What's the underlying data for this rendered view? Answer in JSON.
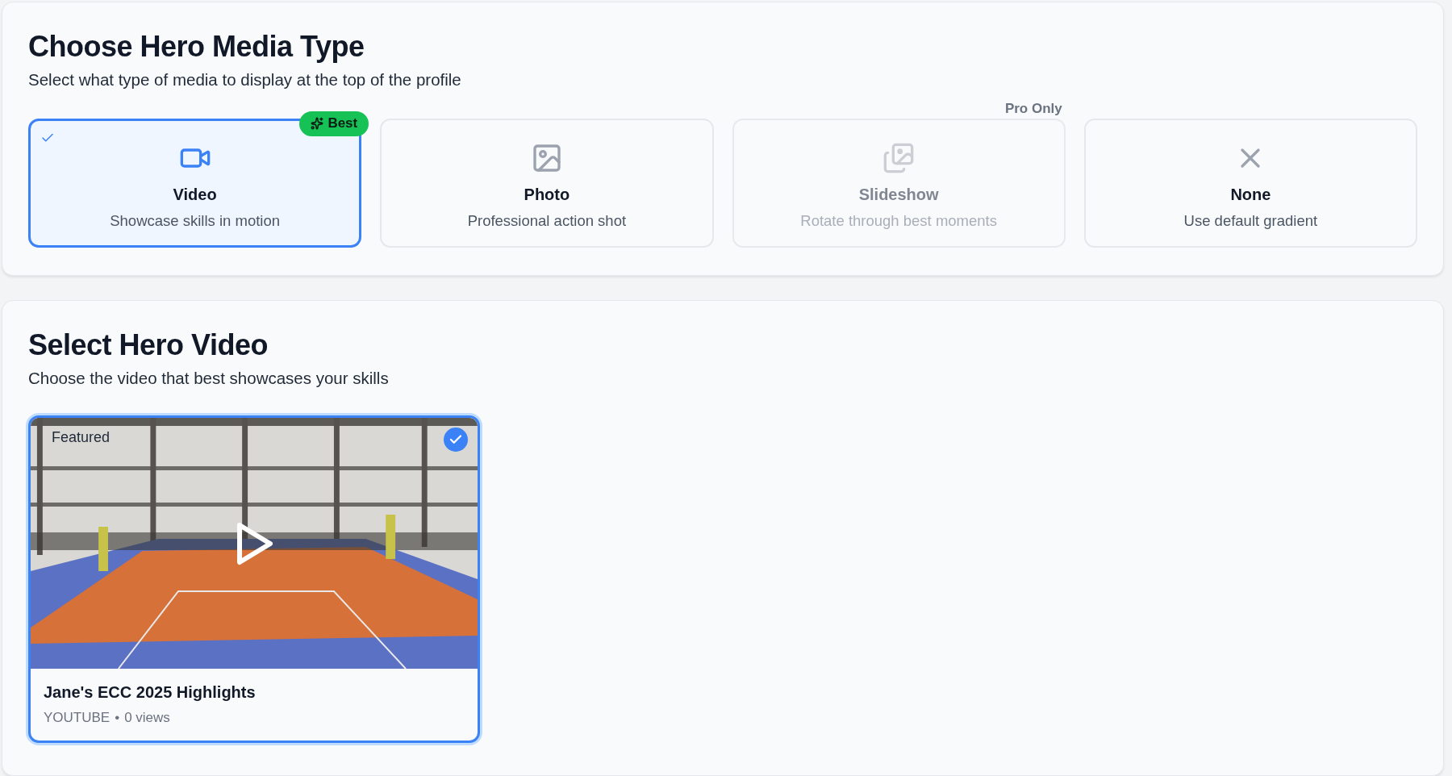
{
  "media_type": {
    "title": "Choose Hero Media Type",
    "subtitle": "Select what type of media to display at the top of the profile",
    "options": [
      {
        "kind": "video",
        "label": "Video",
        "description": "Showcase skills in motion",
        "selected": true,
        "disabled": false,
        "badge": {
          "kind": "best",
          "text": "Best"
        }
      },
      {
        "label": "Photo",
        "description": "Professional action shot",
        "selected": false,
        "disabled": false
      },
      {
        "kind": "slideshow",
        "label": "Slideshow",
        "description": "Rotate through best moments",
        "selected": false,
        "disabled": true,
        "badge": {
          "kind": "pro",
          "text": "Pro Only"
        }
      },
      {
        "kind": "none",
        "label": "None",
        "description": "Use default gradient",
        "selected": false,
        "disabled": false
      }
    ]
  },
  "hero_video": {
    "title": "Select Hero Video",
    "subtitle": "Choose the video that best showcases your skills",
    "videos": [
      {
        "kind": "picture",
        "badge": "Featured",
        "title": "Jane's ECC 2025 Highlights",
        "source": "YOUTUBE",
        "separator": "•",
        "views": "0 views",
        "selected": true
      }
    ]
  }
}
